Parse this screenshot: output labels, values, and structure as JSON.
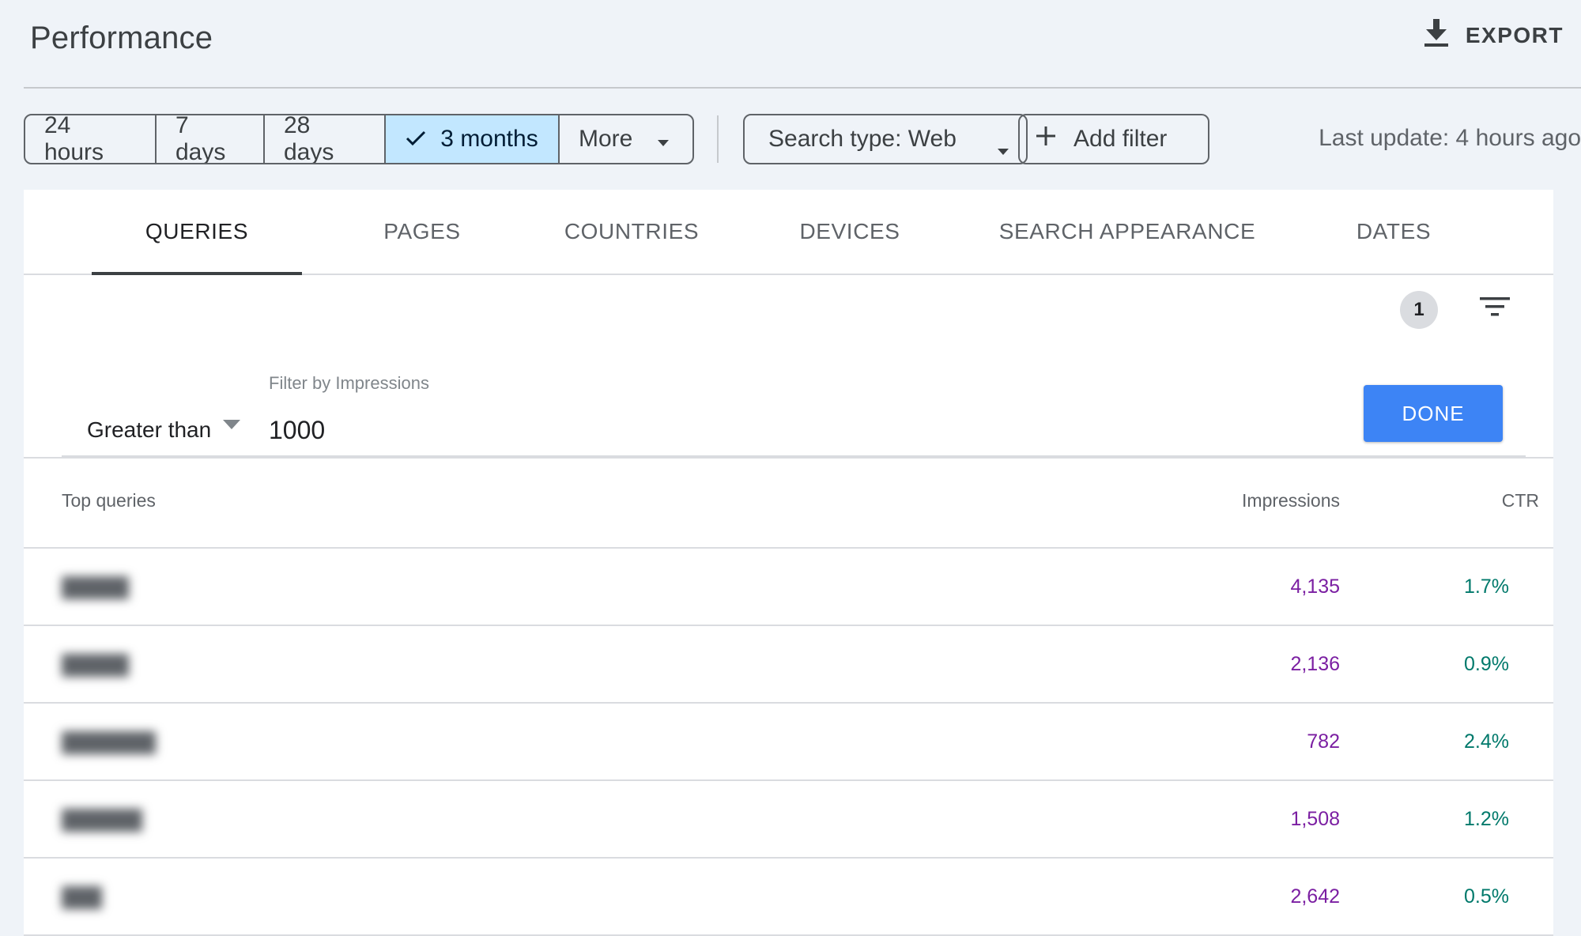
{
  "header": {
    "title": "Performance",
    "export_label": "EXPORT",
    "export_icon": "download-icon"
  },
  "toolbar": {
    "date_ranges": [
      {
        "label": "24 hours",
        "selected": false
      },
      {
        "label": "7 days",
        "selected": false
      },
      {
        "label": "28 days",
        "selected": false
      },
      {
        "label": "3 months",
        "selected": true
      },
      {
        "label": "More",
        "selected": false
      }
    ],
    "search_type_label": "Search type: Web",
    "add_filter_label": "Add filter",
    "last_update": "Last update: 4 hours ago"
  },
  "tabs": [
    {
      "label": "QUERIES",
      "active": true
    },
    {
      "label": "PAGES",
      "active": false
    },
    {
      "label": "COUNTRIES",
      "active": false
    },
    {
      "label": "DEVICES",
      "active": false
    },
    {
      "label": "SEARCH APPEARANCE",
      "active": false
    },
    {
      "label": "DATES",
      "active": false
    }
  ],
  "filter": {
    "active_count": "1",
    "operator": "Greater than",
    "field_label": "Filter by Impressions",
    "value": "1000",
    "done_label": "DONE"
  },
  "table": {
    "columns": {
      "query": "Top queries",
      "impressions": "Impressions",
      "ctr": "CTR"
    },
    "rows": [
      {
        "query": "█████",
        "impressions": "4,135",
        "ctr": "1.7%"
      },
      {
        "query": "█████",
        "impressions": "2,136",
        "ctr": "0.9%"
      },
      {
        "query": "███████",
        "impressions": "782",
        "ctr": "2.4%"
      },
      {
        "query": "██████",
        "impressions": "1,508",
        "ctr": "1.2%"
      },
      {
        "query": "███",
        "impressions": "2,642",
        "ctr": "0.5%"
      }
    ]
  },
  "colors": {
    "accent_blue": "#3d84f5",
    "selected_chip": "#c2e7ff",
    "impressions_purple": "#7b1fa2",
    "ctr_teal": "#00796b",
    "page_bg": "#eff3f8"
  }
}
